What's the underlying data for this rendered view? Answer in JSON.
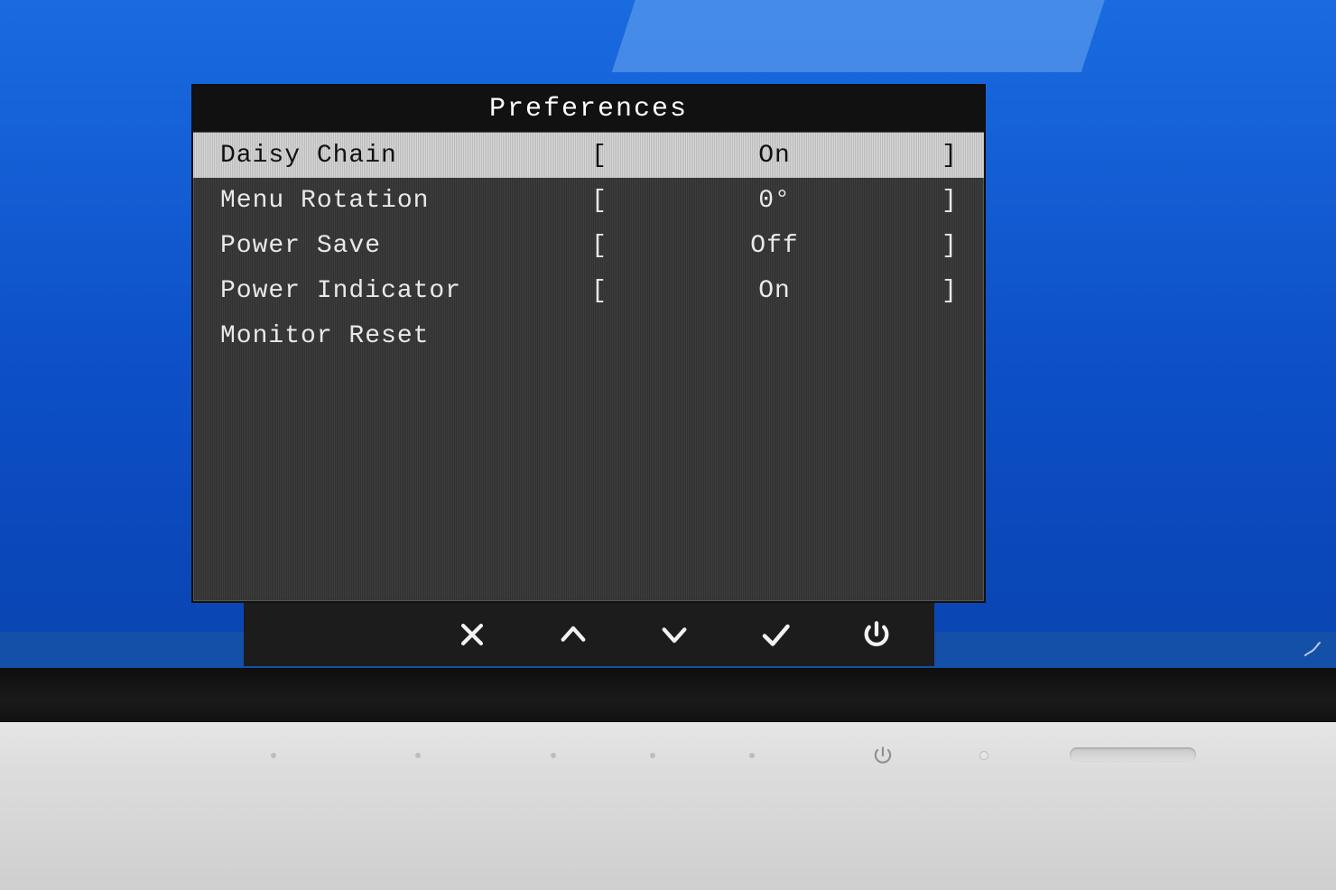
{
  "osd": {
    "title": "Preferences",
    "rows": [
      {
        "label": "Daisy Chain",
        "value": "On",
        "selected": true
      },
      {
        "label": "Menu Rotation",
        "value": "0°",
        "selected": false
      },
      {
        "label": "Power Save",
        "value": "Off",
        "selected": false
      },
      {
        "label": "Power Indicator",
        "value": "On",
        "selected": false
      },
      {
        "label": "Monitor Reset",
        "value": "",
        "selected": false
      }
    ],
    "brackets": {
      "left": "[",
      "right": "]"
    }
  },
  "osd_nav": {
    "close": "close-icon",
    "up": "chevron-up-icon",
    "down": "chevron-down-icon",
    "confirm": "check-icon",
    "power": "power-icon"
  }
}
